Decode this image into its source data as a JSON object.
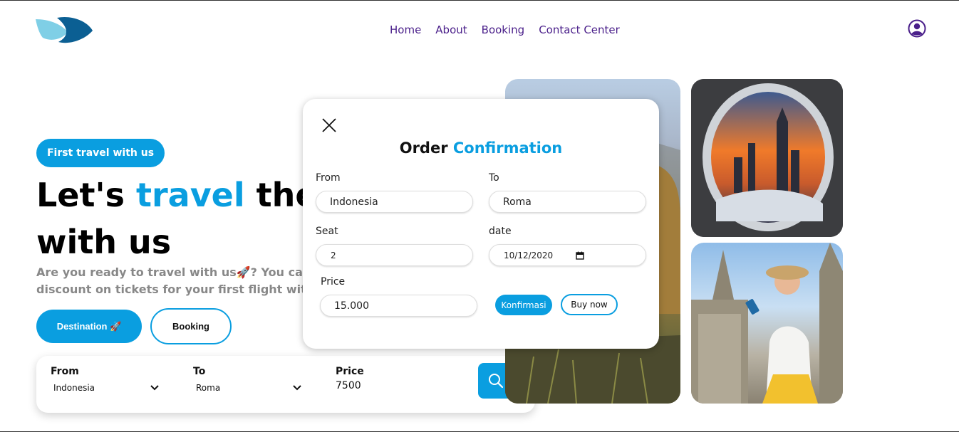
{
  "header": {
    "nav": [
      "Home",
      "About",
      "Booking",
      "Contact Center"
    ]
  },
  "hero": {
    "pill_label": "First travel with us",
    "title_part1": "Let's ",
    "title_accent": "travel",
    "title_part2": " the w",
    "title_line2": "with us",
    "subtitle_line1": "Are you ready to travel with us🚀? You can ge",
    "subtitle_line2": "discount on tickets for your first flight with us",
    "destination_button": "Destination 🚀",
    "booking_button": "Booking"
  },
  "search": {
    "from_label": "From",
    "from_value": "Indonesia",
    "to_label": "To",
    "to_value": "Roma",
    "price_label": "Price",
    "price_value": "7500"
  },
  "modal": {
    "title_part1": "Order ",
    "title_accent": "Confirmation",
    "from_label": "From",
    "from_value": "Indonesia",
    "to_label": "To",
    "to_value": "Roma",
    "seat_label": "Seat",
    "seat_value": "2",
    "date_label": "date",
    "date_value": "10/12/2020",
    "price_label": "Price",
    "price_value": "15.000",
    "confirm_button": "Konfirmasi",
    "buy_button": "Buy now"
  },
  "colors": {
    "accent": "#0a9ee0",
    "nav_text": "#4a1f8a"
  },
  "icons": [
    "logo-icon",
    "user-icon",
    "close-icon",
    "search-icon",
    "chevron-down-icon",
    "calendar-icon"
  ]
}
